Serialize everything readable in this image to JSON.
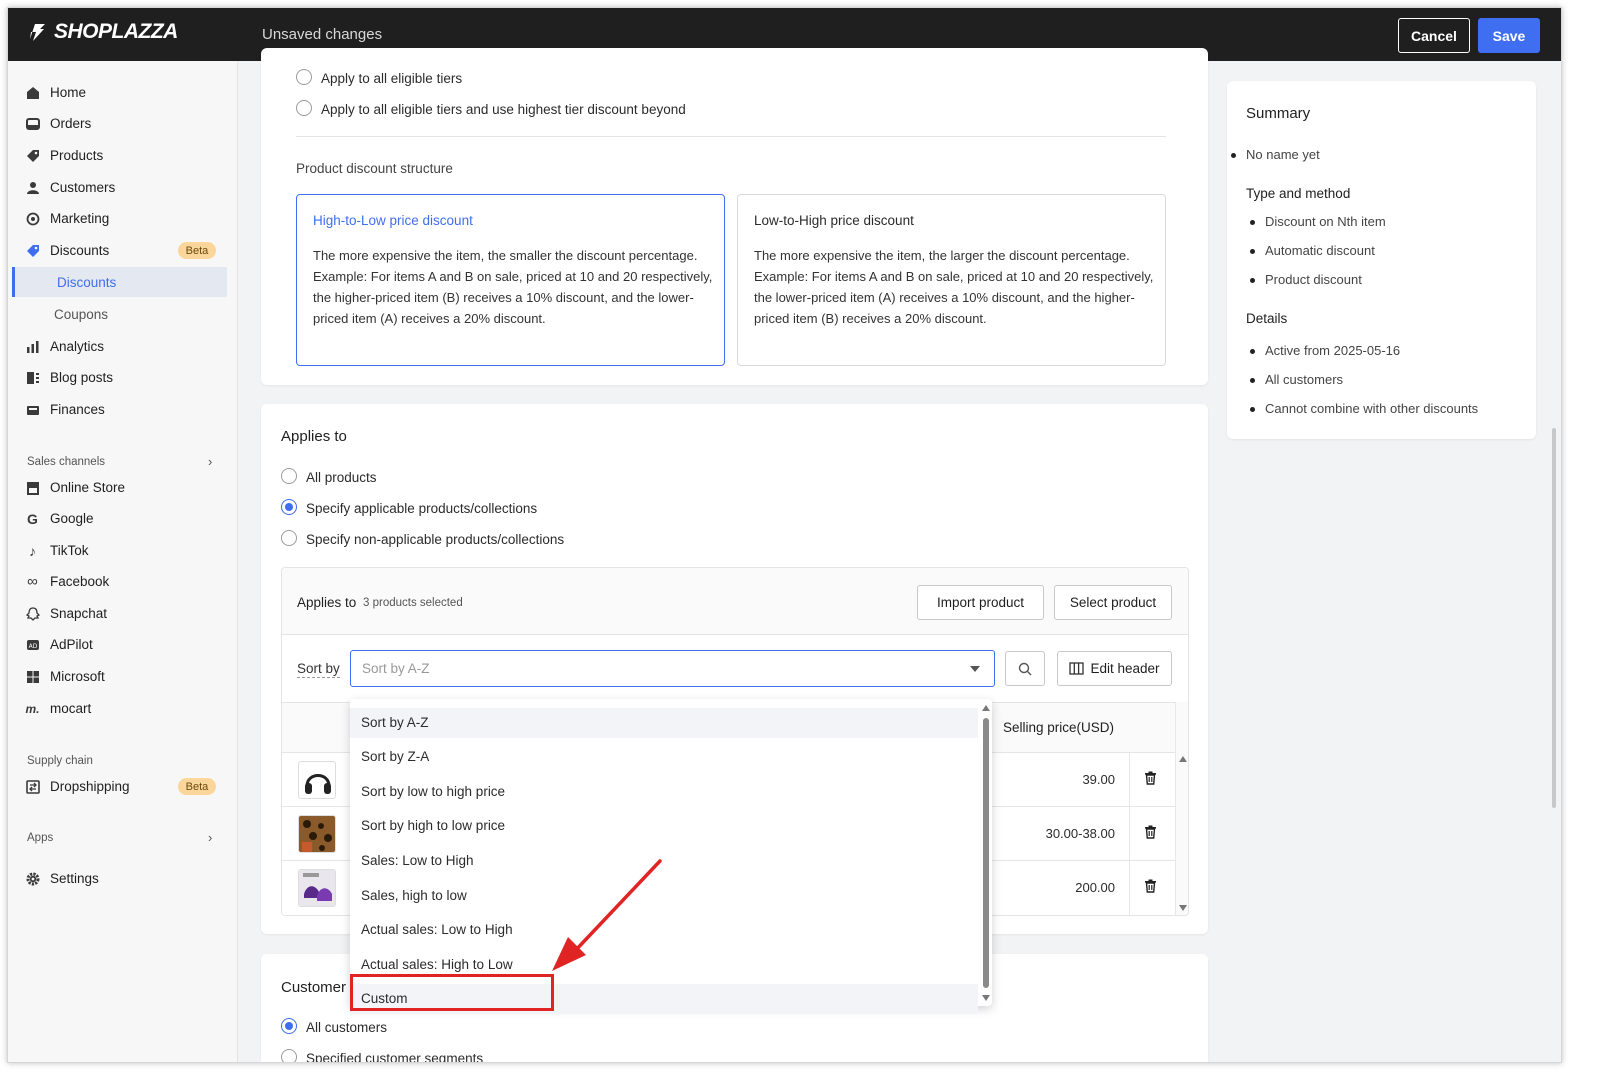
{
  "topbar": {
    "logo": "SHOPLAZZA",
    "status": "Unsaved changes",
    "cancel_label": "Cancel",
    "save_label": "Save"
  },
  "sidebar": {
    "items": [
      {
        "label": "Home"
      },
      {
        "label": "Orders"
      },
      {
        "label": "Products"
      },
      {
        "label": "Customers"
      },
      {
        "label": "Marketing"
      },
      {
        "label": "Discounts",
        "badge": "Beta"
      },
      {
        "label": "Discounts"
      },
      {
        "label": "Coupons"
      },
      {
        "label": "Analytics"
      },
      {
        "label": "Blog posts"
      },
      {
        "label": "Finances"
      }
    ],
    "sales_channels_label": "Sales channels",
    "sales_channels": [
      {
        "label": "Online Store"
      },
      {
        "label": "Google"
      },
      {
        "label": "TikTok"
      },
      {
        "label": "Facebook"
      },
      {
        "label": "Snapchat"
      },
      {
        "label": "AdPilot"
      },
      {
        "label": "Microsoft"
      },
      {
        "label": "mocart"
      }
    ],
    "supply_chain_label": "Supply chain",
    "dropshipping": {
      "label": "Dropshipping",
      "badge": "Beta"
    },
    "apps_label": "Apps",
    "settings_label": "Settings"
  },
  "tiers": {
    "options": [
      "Apply to all eligible tiers",
      "Apply to all eligible tiers and use highest tier discount beyond"
    ],
    "structure_label": "Product discount structure",
    "high_to_low": {
      "title": "High-to-Low price discount",
      "body": "The more expensive the item, the smaller the discount percentage. Example: For items A and B on sale, priced at 10 and 20 respectively, the higher-priced item (B) receives a 10% discount, and the lower-priced item (A) receives a 20% discount."
    },
    "low_to_high": {
      "title": "Low-to-High price discount",
      "body": "The more expensive the item, the larger the discount percentage. Example: For items A and B on sale, priced at 10 and 20 respectively, the lower-priced item (A) receives a 10% discount, and the higher-priced item (B) receives a 20% discount."
    }
  },
  "applies_to": {
    "title": "Applies to",
    "options": [
      "All products",
      "Specify applicable products/collections",
      "Specify non-applicable products/collections"
    ],
    "panel_title": "Applies to",
    "selected_count": "3 products selected",
    "import_label": "Import product",
    "select_label": "Select product",
    "sort_label": "Sort by",
    "sort_placeholder": "Sort by A-Z",
    "edit_header_label": "Edit header",
    "column_price": "Selling price(USD)",
    "rows": [
      {
        "price": "39.00"
      },
      {
        "price": "30.00-38.00"
      },
      {
        "price": "200.00"
      }
    ]
  },
  "sort_options": [
    "Sort by A-Z",
    "Sort by Z-A",
    "Sort by low to high price",
    "Sort by high to low price",
    "Sales: Low to High",
    "Sales, high to low",
    "Actual sales: Low to High",
    "Actual sales: High to Low",
    "Custom"
  ],
  "customer": {
    "title": "Customer",
    "options": [
      "All customers",
      "Specified customer segments"
    ]
  },
  "summary": {
    "title": "Summary",
    "name": "No name yet",
    "type_heading": "Type and method",
    "type_items": [
      "Discount on Nth item",
      "Automatic discount",
      "Product discount"
    ],
    "details_heading": "Details",
    "details_items": [
      "Active from 2025-05-16",
      "All customers",
      "Cannot combine with other discounts"
    ]
  },
  "colors": {
    "accent": "#3f6ef0",
    "topbar": "#1f1f1f",
    "highlight": "#e02424",
    "beta": "#fbd59a"
  }
}
